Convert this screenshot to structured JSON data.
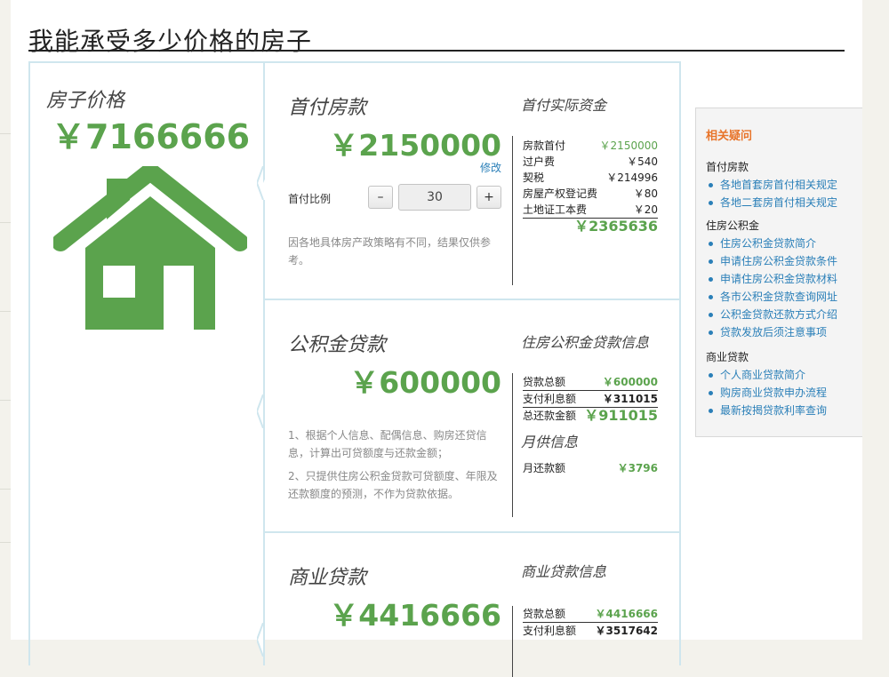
{
  "page_title": "我能承受多少价格的房子",
  "house_price": {
    "label": "房子价格",
    "value": "￥7166666"
  },
  "down_payment": {
    "title": "首付房款",
    "amount": "￥2150000",
    "modify_label": "修改",
    "ratio_label": "首付比例",
    "ratio_value": "30",
    "minus_label": "–",
    "plus_label": "+",
    "note": "因各地具体房产政策略有不同，结果仅供参考。",
    "info_title": "首付实际资金",
    "rows": [
      {
        "k": "房款首付",
        "v": "￥2150000"
      },
      {
        "k": "过户费",
        "v": "￥540"
      },
      {
        "k": "契税",
        "v": "￥214996"
      },
      {
        "k": "房屋产权登记费",
        "v": "￥80"
      },
      {
        "k": "土地证工本费",
        "v": "￥20"
      }
    ],
    "total": "￥2365636"
  },
  "fund_loan": {
    "title": "公积金贷款",
    "amount": "￥600000",
    "note1": "1、根据个人信息、配偶信息、购房还贷信息，计算出可贷额度与还款金额；",
    "note2": "2、只提供住房公积金贷款可贷额度、年限及还款额度的预测，不作为贷款依据。",
    "info_title": "住房公积金贷款信息",
    "rows": [
      {
        "k": "贷款总额",
        "v": "￥600000"
      },
      {
        "k": "支付利息额",
        "v": "￥311015"
      }
    ],
    "total_label": "总还款金额",
    "total": "￥911015",
    "monthly_title": "月供信息",
    "monthly_label": "月还款额",
    "monthly_value": "￥3796"
  },
  "commercial_loan": {
    "title": "商业贷款",
    "amount": "￥4416666",
    "info_title": "商业贷款信息",
    "rows": [
      {
        "k": "贷款总额",
        "v": "￥4416666"
      },
      {
        "k": "支付利息额",
        "v": "￥3517642"
      }
    ]
  },
  "sidebar": {
    "title": "相关疑问",
    "groups": [
      {
        "heading": "首付房款",
        "links": [
          "各地首套房首付相关规定",
          "各地二套房首付相关规定"
        ]
      },
      {
        "heading": "住房公积金",
        "links": [
          "住房公积金贷款简介",
          "申请住房公积金贷款条件",
          "申请住房公积金贷款材料",
          "各市公积金贷款查询网址",
          "公积金贷款还款方式介绍",
          "贷款发放后须注意事项"
        ]
      },
      {
        "heading": "商业贷款",
        "links": [
          "个人商业贷款简介",
          "购房商业贷款申办流程",
          "最新按揭贷款利率查询"
        ]
      }
    ]
  },
  "colors": {
    "accent_green": "#5ba34d",
    "link_blue": "#2a7fb8",
    "orange": "#e8752b",
    "border_blue": "#cfe6ee"
  }
}
